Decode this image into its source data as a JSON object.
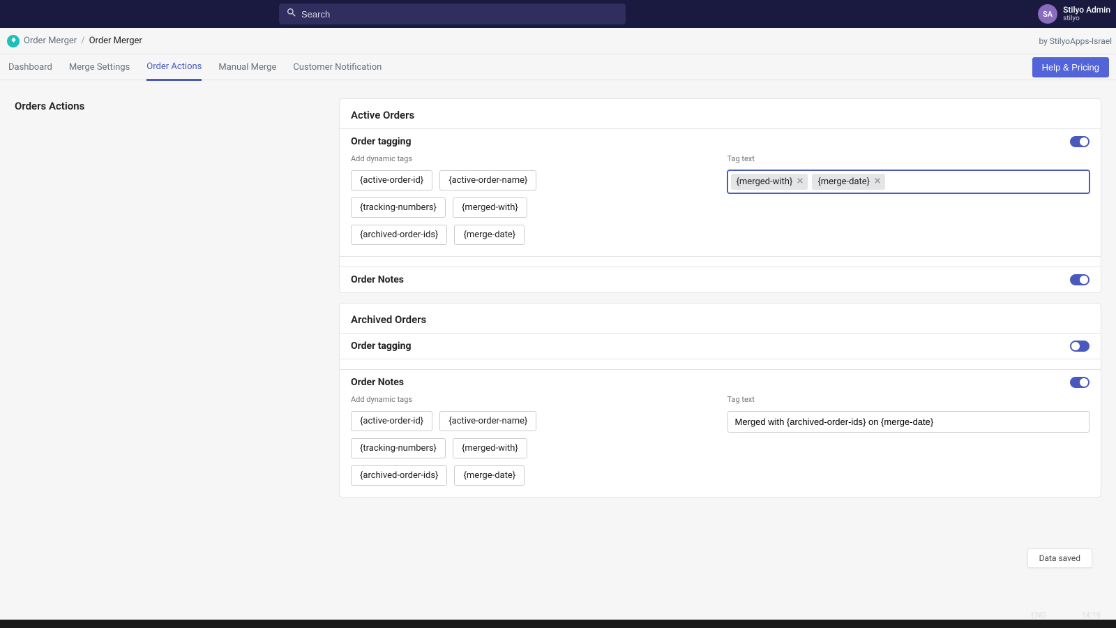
{
  "topbar": {
    "search_placeholder": "Search",
    "avatar_initials": "SA",
    "user_name": "Stilyo Admin",
    "user_sub": "stilyo"
  },
  "crumb": {
    "app": "Order Merger",
    "page": "Order Merger",
    "by": "by StilyoApps-Israel"
  },
  "tabs": {
    "dashboard": "Dashboard",
    "merge_settings": "Merge Settings",
    "order_actions": "Order Actions",
    "manual_merge": "Manual Merge",
    "customer_notification": "Customer Notification",
    "help": "Help & Pricing"
  },
  "left": {
    "title": "Orders Actions"
  },
  "active": {
    "title": "Active Orders",
    "tagging": {
      "title": "Order tagging",
      "add_label": "Add dynamic tags",
      "tags": {
        "t0": "{active-order-id}",
        "t1": "{active-order-name}",
        "t2": "{tracking-numbers}",
        "t3": "{merged-with}",
        "t4": "{archived-order-ids}",
        "t5": "{merge-date}"
      },
      "tagtext_label": "Tag text",
      "selected": {
        "s0": "{merged-with}",
        "s1": "{merge-date}"
      }
    },
    "notes": {
      "title": "Order Notes"
    }
  },
  "archived": {
    "title": "Archived Orders",
    "tagging": {
      "title": "Order tagging"
    },
    "notes": {
      "title": "Order Notes",
      "add_label": "Add dynamic tags",
      "tags": {
        "t0": "{active-order-id}",
        "t1": "{active-order-name}",
        "t2": "{tracking-numbers}",
        "t3": "{merged-with}",
        "t4": "{archived-order-ids}",
        "t5": "{merge-date}"
      },
      "tagtext_label": "Tag text",
      "text_value": "Merged with {archived-order-ids} on {merge-date}"
    }
  },
  "toast": "Data saved",
  "system": {
    "lang": "ENG",
    "time": "14:19"
  }
}
